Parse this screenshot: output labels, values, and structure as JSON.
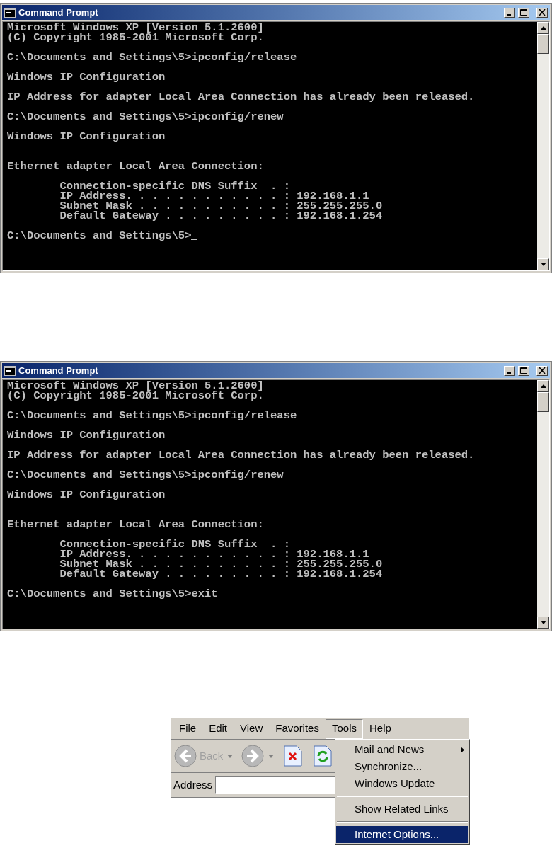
{
  "windows": [
    {
      "title": "Command Prompt",
      "cursor": true,
      "lines": [
        {
          "kind": "line",
          "text": "Microsoft Windows XP [Version 5.1.2600]"
        },
        {
          "kind": "line",
          "text": "(C) Copyright 1985-2001 Microsoft Corp."
        },
        {
          "kind": "blank"
        },
        {
          "kind": "line",
          "text": "C:\\Documents and Settings\\5>ipconfig/release"
        },
        {
          "kind": "blank"
        },
        {
          "kind": "line",
          "text": "Windows IP Configuration"
        },
        {
          "kind": "blank"
        },
        {
          "kind": "line",
          "text": "IP Address for adapter Local Area Connection has already been released."
        },
        {
          "kind": "blank"
        },
        {
          "kind": "line",
          "text": "C:\\Documents and Settings\\5>ipconfig/renew"
        },
        {
          "kind": "blank"
        },
        {
          "kind": "line",
          "text": "Windows IP Configuration"
        },
        {
          "kind": "blank"
        },
        {
          "kind": "blank"
        },
        {
          "kind": "line",
          "text": "Ethernet adapter Local Area Connection:"
        },
        {
          "kind": "blank"
        },
        {
          "kind": "line",
          "text": "        Connection-specific DNS Suffix  . :"
        },
        {
          "kind": "line",
          "text": "        IP Address. . . . . . . . . . . . : 192.168.1.1"
        },
        {
          "kind": "line",
          "text": "        Subnet Mask . . . . . . . . . . . : 255.255.255.0"
        },
        {
          "kind": "line",
          "text": "        Default Gateway . . . . . . . . . : 192.168.1.254"
        },
        {
          "kind": "blank"
        },
        {
          "kind": "line",
          "text": "C:\\Documents and Settings\\5>"
        }
      ]
    },
    {
      "title": "Command Prompt",
      "cursor": false,
      "lines": [
        {
          "kind": "line",
          "text": "Microsoft Windows XP [Version 5.1.2600]"
        },
        {
          "kind": "line",
          "text": "(C) Copyright 1985-2001 Microsoft Corp."
        },
        {
          "kind": "blank"
        },
        {
          "kind": "line",
          "text": "C:\\Documents and Settings\\5>ipconfig/release"
        },
        {
          "kind": "blank"
        },
        {
          "kind": "line",
          "text": "Windows IP Configuration"
        },
        {
          "kind": "blank"
        },
        {
          "kind": "line",
          "text": "IP Address for adapter Local Area Connection has already been released."
        },
        {
          "kind": "blank"
        },
        {
          "kind": "line",
          "text": "C:\\Documents and Settings\\5>ipconfig/renew"
        },
        {
          "kind": "blank"
        },
        {
          "kind": "line",
          "text": "Windows IP Configuration"
        },
        {
          "kind": "blank"
        },
        {
          "kind": "blank"
        },
        {
          "kind": "line",
          "text": "Ethernet adapter Local Area Connection:"
        },
        {
          "kind": "blank"
        },
        {
          "kind": "line",
          "text": "        Connection-specific DNS Suffix  . :"
        },
        {
          "kind": "line",
          "text": "        IP Address. . . . . . . . . . . . : 192.168.1.1"
        },
        {
          "kind": "line",
          "text": "        Subnet Mask . . . . . . . . . . . : 255.255.255.0"
        },
        {
          "kind": "line",
          "text": "        Default Gateway . . . . . . . . . : 192.168.1.254"
        },
        {
          "kind": "blank"
        },
        {
          "kind": "line",
          "text": "C:\\Documents and Settings\\5>exit"
        }
      ]
    }
  ],
  "browser": {
    "menu_bar": [
      {
        "label": "File",
        "selected": false
      },
      {
        "label": "Edit",
        "selected": false
      },
      {
        "label": "View",
        "selected": false
      },
      {
        "label": "Favorites",
        "selected": false
      },
      {
        "label": "Tools",
        "selected": true
      },
      {
        "label": "Help",
        "selected": false
      }
    ],
    "back": {
      "label": "Back",
      "disabled": true
    },
    "address": {
      "label": "Address"
    },
    "dropdown": [
      {
        "kind": "item",
        "label": "Mail and News",
        "submenu": true,
        "selected": false
      },
      {
        "kind": "item",
        "label": "Synchronize...",
        "submenu": false,
        "selected": false
      },
      {
        "kind": "item",
        "label": "Windows Update",
        "submenu": false,
        "selected": false
      },
      {
        "kind": "separator"
      },
      {
        "kind": "item",
        "label": "Show Related Links",
        "submenu": false,
        "selected": false
      },
      {
        "kind": "separator"
      },
      {
        "kind": "item",
        "label": "Internet Options...",
        "submenu": false,
        "selected": true
      }
    ]
  }
}
